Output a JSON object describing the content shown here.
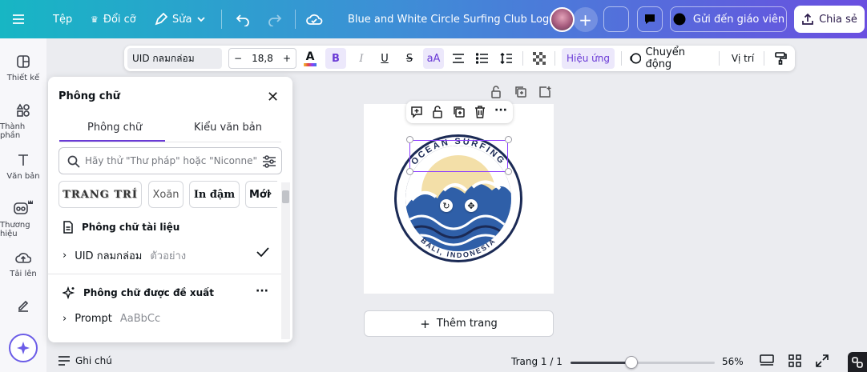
{
  "topbar": {
    "menu_icon": "hamburger-icon",
    "file_label": "Tệp",
    "resize_label": "Đổi cỡ",
    "edit_label": "Sửa",
    "document_title": "Blue and White Circle Surfing Club Logo",
    "send_to_teacher_label": "Gửi đến giáo viên",
    "share_label": "Chia sẻ"
  },
  "rail": {
    "items": [
      {
        "label": "Thiết kế",
        "icon": "layout-icon"
      },
      {
        "label": "Thành phần",
        "icon": "elements-icon"
      },
      {
        "label": "Văn bản",
        "icon": "text-icon"
      },
      {
        "label": "Thương hiệu",
        "icon": "brand-icon"
      },
      {
        "label": "Tải lên",
        "icon": "upload-icon"
      }
    ]
  },
  "format_toolbar": {
    "font_name": "UID กลมกล่อม",
    "font_size": "18,8",
    "bold": "B",
    "italic": "I",
    "underline": "U",
    "strike": "S",
    "case": "aA",
    "effects_label": "Hiệu ứng",
    "animate_label": "Chuyển động",
    "position_label": "Vị trí"
  },
  "font_panel": {
    "title": "Phông chữ",
    "tabs": [
      "Phông chữ",
      "Kiểu văn bản"
    ],
    "search_placeholder": "Hãy thử \"Thư pháp\" hoặc \"Niconne\"",
    "filter_chips": [
      "TRANG TRÍ",
      "Xoăn",
      "In đậm",
      "Mới"
    ],
    "document_fonts_heading": "Phông chữ tài liệu",
    "document_font": {
      "name": "UID กลมกล่อม",
      "sample": "ตัวอย่าง"
    },
    "suggested_heading": "Phông chữ được đề xuất",
    "suggested_font": {
      "name": "Prompt",
      "sample": "AaBbCc"
    }
  },
  "canvas": {
    "logo_top_text": "OCEAN SURFING",
    "logo_bottom_text": "BALI, INDONESIA",
    "add_page_label": "Thêm trang"
  },
  "bottom": {
    "notes_label": "Ghi chú",
    "page_indicator": "Trang 1 / 1",
    "zoom": "56%",
    "zoom_fraction": 0.42
  },
  "colors": {
    "accent": "#6a3ad6",
    "logo_navy": "#1b2a55",
    "logo_sand": "#f3dfa8",
    "logo_blue": "#2f5fa8"
  }
}
